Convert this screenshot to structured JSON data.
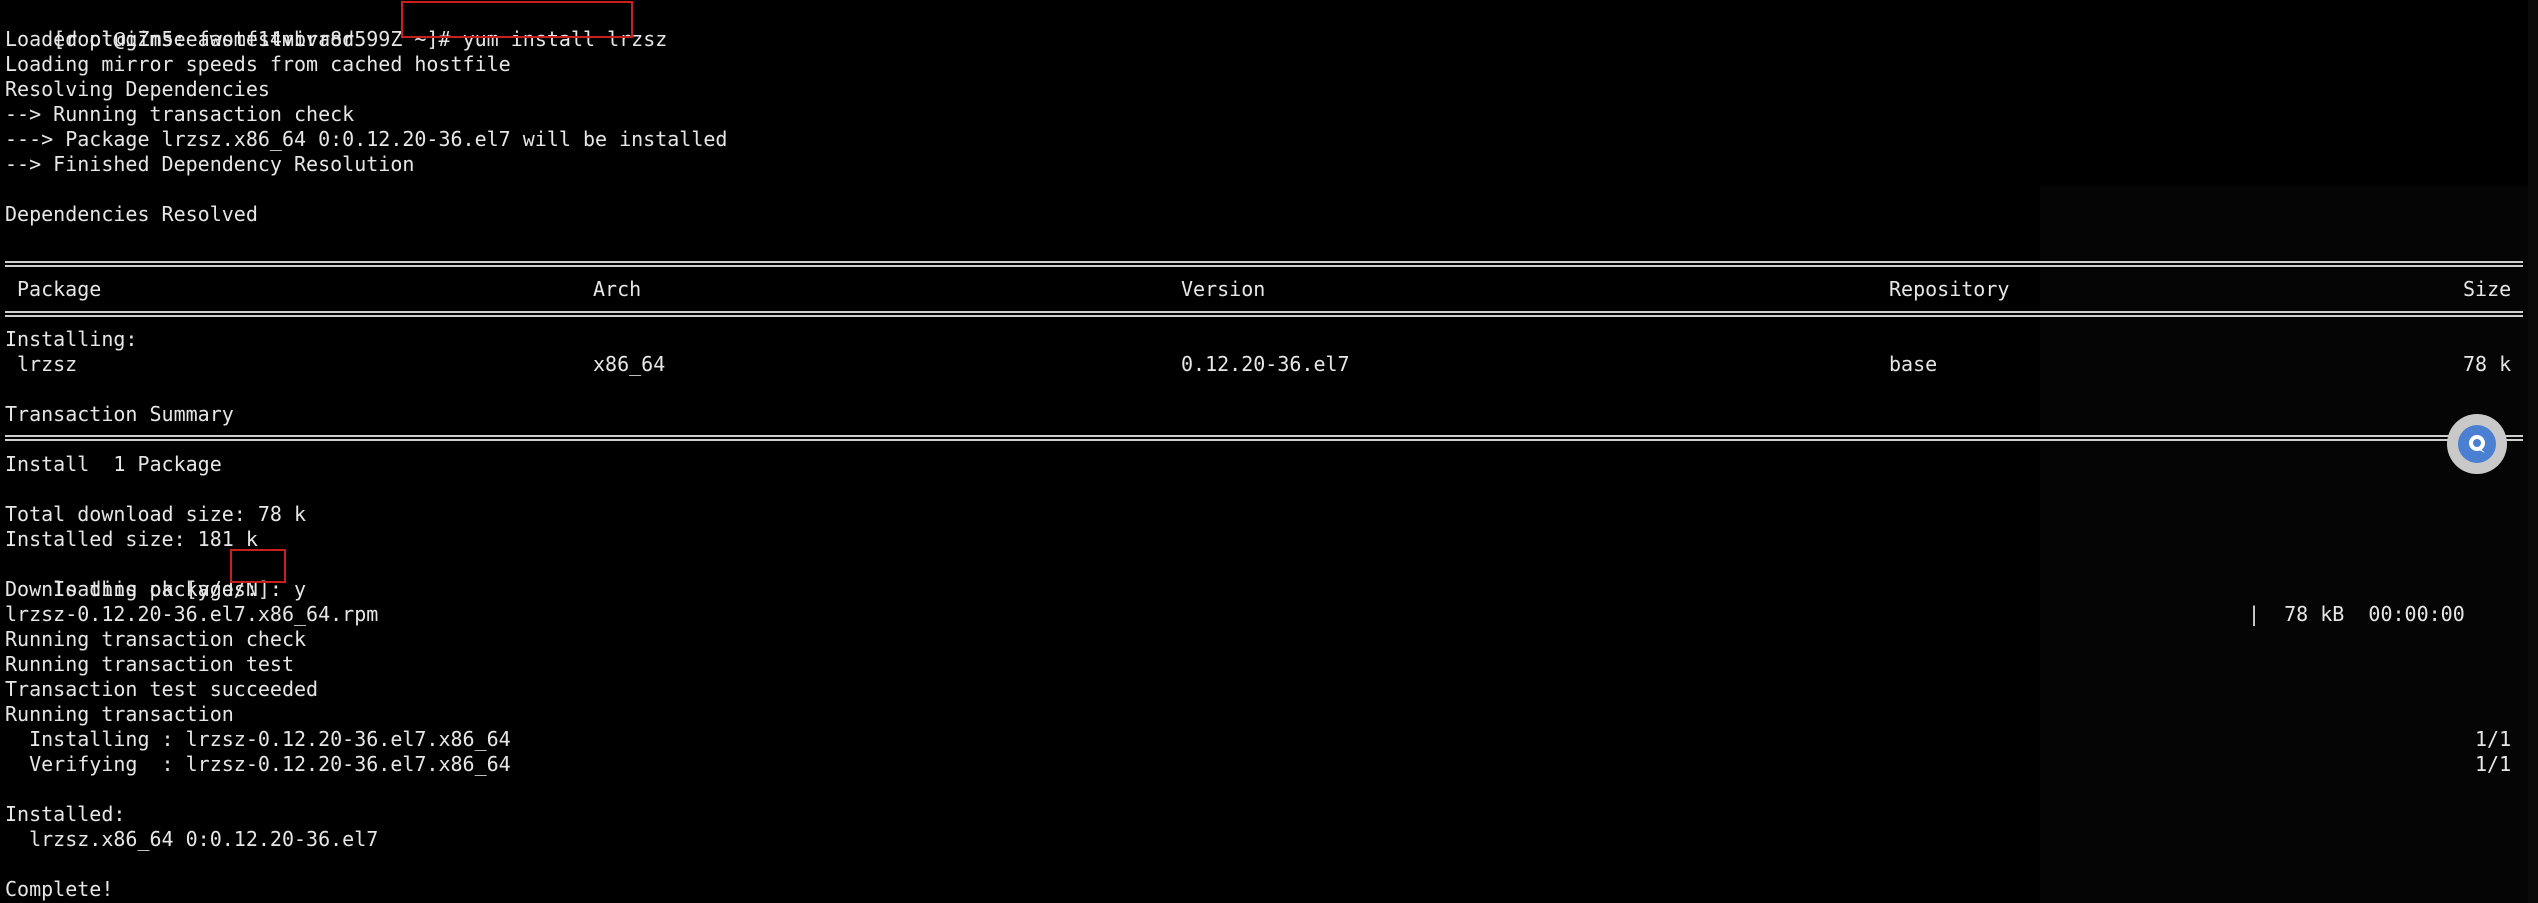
{
  "terminal": {
    "prompt": "[root@iZm5eeawomf14vbva8d599Z ~]#",
    "command": "yum install lrzsz",
    "pre_lines": [
      "Loaded plugins: fastestmirror",
      "Loading mirror speeds from cached hostfile",
      "Resolving Dependencies",
      "--> Running transaction check",
      "---> Package lrzsz.x86_64 0:0.12.20-36.el7 will be installed",
      "--> Finished Dependency Resolution",
      "Dependencies Resolved"
    ],
    "table": {
      "headers": [
        "Package",
        "Arch",
        "Version",
        "Repository",
        "Size"
      ],
      "section": "Installing:",
      "row": [
        "lrzsz",
        "x86_64",
        "0.12.20-36.el7",
        "base",
        "78 k"
      ]
    },
    "summary": {
      "title": "Transaction Summary",
      "install_line": "Install  1 Package",
      "total_download": "Total download size: 78 k",
      "installed_size": "Installed size: 181 k",
      "confirm_prompt": "Is this ok [y/d/N]:",
      "confirm_answer": "y"
    },
    "download": {
      "header": "Downloading packages:",
      "file": "lrzsz-0.12.20-36.el7.x86_64.rpm",
      "stats": "|  78 kB  00:00:00"
    },
    "transaction_lines": [
      "Running transaction check",
      "Running transaction test",
      "Transaction test succeeded",
      "Running transaction"
    ],
    "steps": [
      {
        "text": "  Installing : lrzsz-0.12.20-36.el7.x86_64",
        "count": "1/1"
      },
      {
        "text": "  Verifying  : lrzsz-0.12.20-36.el7.x86_64",
        "count": "1/1"
      }
    ],
    "installed_header": "Installed:",
    "installed_pkg": "  lrzsz.x86_64 0:0.12.20-36.el7",
    "complete": "Complete!"
  },
  "colors": {
    "background": "#000000",
    "text": "#e6e6e6",
    "highlight_box": "#c8201e",
    "floating_button": "#4a7fd1"
  },
  "icons": {
    "floating_button": "chat-bubble-icon"
  }
}
